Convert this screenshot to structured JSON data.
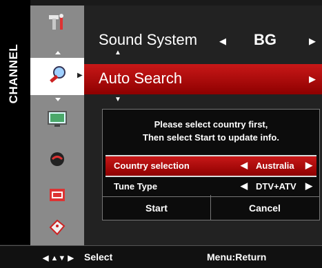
{
  "side_label": "CHANNEL",
  "menu": {
    "sound_system": {
      "label": "Sound System",
      "value": "BG"
    },
    "auto_search": {
      "label": "Auto Search"
    }
  },
  "dialog": {
    "message_line1": "Please select country first,",
    "message_line2": "Then select Start to update info.",
    "options": [
      {
        "label": "Country selection",
        "value": "Australia"
      },
      {
        "label": "Tune Type",
        "value": "DTV+ATV"
      }
    ],
    "start_label": "Start",
    "cancel_label": "Cancel"
  },
  "bottom": {
    "select_hint": "Select",
    "return_hint": "Menu:Return"
  },
  "icons": [
    "tools-icon",
    "search-icon",
    "tv-screen-icon",
    "ball-icon",
    "media-icon",
    "tag-icon"
  ],
  "colors": {
    "highlight": "#c81818",
    "panel": "#222222",
    "icon_column": "#8a8a8a"
  }
}
